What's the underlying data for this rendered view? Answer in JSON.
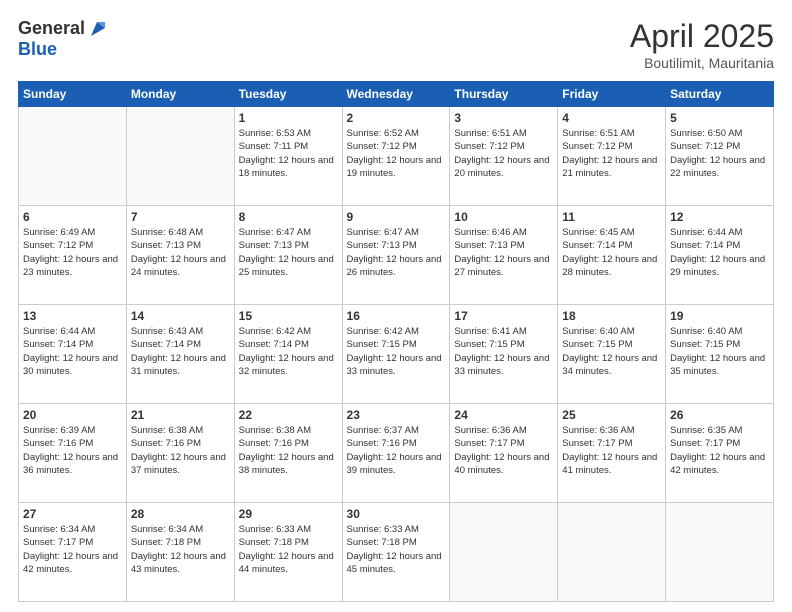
{
  "logo": {
    "general": "General",
    "blue": "Blue"
  },
  "title": "April 2025",
  "location": "Boutilimit, Mauritania",
  "days_of_week": [
    "Sunday",
    "Monday",
    "Tuesday",
    "Wednesday",
    "Thursday",
    "Friday",
    "Saturday"
  ],
  "weeks": [
    [
      {
        "day": "",
        "info": ""
      },
      {
        "day": "",
        "info": ""
      },
      {
        "day": "1",
        "info": "Sunrise: 6:53 AM\nSunset: 7:11 PM\nDaylight: 12 hours and 18 minutes."
      },
      {
        "day": "2",
        "info": "Sunrise: 6:52 AM\nSunset: 7:12 PM\nDaylight: 12 hours and 19 minutes."
      },
      {
        "day": "3",
        "info": "Sunrise: 6:51 AM\nSunset: 7:12 PM\nDaylight: 12 hours and 20 minutes."
      },
      {
        "day": "4",
        "info": "Sunrise: 6:51 AM\nSunset: 7:12 PM\nDaylight: 12 hours and 21 minutes."
      },
      {
        "day": "5",
        "info": "Sunrise: 6:50 AM\nSunset: 7:12 PM\nDaylight: 12 hours and 22 minutes."
      }
    ],
    [
      {
        "day": "6",
        "info": "Sunrise: 6:49 AM\nSunset: 7:12 PM\nDaylight: 12 hours and 23 minutes."
      },
      {
        "day": "7",
        "info": "Sunrise: 6:48 AM\nSunset: 7:13 PM\nDaylight: 12 hours and 24 minutes."
      },
      {
        "day": "8",
        "info": "Sunrise: 6:47 AM\nSunset: 7:13 PM\nDaylight: 12 hours and 25 minutes."
      },
      {
        "day": "9",
        "info": "Sunrise: 6:47 AM\nSunset: 7:13 PM\nDaylight: 12 hours and 26 minutes."
      },
      {
        "day": "10",
        "info": "Sunrise: 6:46 AM\nSunset: 7:13 PM\nDaylight: 12 hours and 27 minutes."
      },
      {
        "day": "11",
        "info": "Sunrise: 6:45 AM\nSunset: 7:14 PM\nDaylight: 12 hours and 28 minutes."
      },
      {
        "day": "12",
        "info": "Sunrise: 6:44 AM\nSunset: 7:14 PM\nDaylight: 12 hours and 29 minutes."
      }
    ],
    [
      {
        "day": "13",
        "info": "Sunrise: 6:44 AM\nSunset: 7:14 PM\nDaylight: 12 hours and 30 minutes."
      },
      {
        "day": "14",
        "info": "Sunrise: 6:43 AM\nSunset: 7:14 PM\nDaylight: 12 hours and 31 minutes."
      },
      {
        "day": "15",
        "info": "Sunrise: 6:42 AM\nSunset: 7:14 PM\nDaylight: 12 hours and 32 minutes."
      },
      {
        "day": "16",
        "info": "Sunrise: 6:42 AM\nSunset: 7:15 PM\nDaylight: 12 hours and 33 minutes."
      },
      {
        "day": "17",
        "info": "Sunrise: 6:41 AM\nSunset: 7:15 PM\nDaylight: 12 hours and 33 minutes."
      },
      {
        "day": "18",
        "info": "Sunrise: 6:40 AM\nSunset: 7:15 PM\nDaylight: 12 hours and 34 minutes."
      },
      {
        "day": "19",
        "info": "Sunrise: 6:40 AM\nSunset: 7:15 PM\nDaylight: 12 hours and 35 minutes."
      }
    ],
    [
      {
        "day": "20",
        "info": "Sunrise: 6:39 AM\nSunset: 7:16 PM\nDaylight: 12 hours and 36 minutes."
      },
      {
        "day": "21",
        "info": "Sunrise: 6:38 AM\nSunset: 7:16 PM\nDaylight: 12 hours and 37 minutes."
      },
      {
        "day": "22",
        "info": "Sunrise: 6:38 AM\nSunset: 7:16 PM\nDaylight: 12 hours and 38 minutes."
      },
      {
        "day": "23",
        "info": "Sunrise: 6:37 AM\nSunset: 7:16 PM\nDaylight: 12 hours and 39 minutes."
      },
      {
        "day": "24",
        "info": "Sunrise: 6:36 AM\nSunset: 7:17 PM\nDaylight: 12 hours and 40 minutes."
      },
      {
        "day": "25",
        "info": "Sunrise: 6:36 AM\nSunset: 7:17 PM\nDaylight: 12 hours and 41 minutes."
      },
      {
        "day": "26",
        "info": "Sunrise: 6:35 AM\nSunset: 7:17 PM\nDaylight: 12 hours and 42 minutes."
      }
    ],
    [
      {
        "day": "27",
        "info": "Sunrise: 6:34 AM\nSunset: 7:17 PM\nDaylight: 12 hours and 42 minutes."
      },
      {
        "day": "28",
        "info": "Sunrise: 6:34 AM\nSunset: 7:18 PM\nDaylight: 12 hours and 43 minutes."
      },
      {
        "day": "29",
        "info": "Sunrise: 6:33 AM\nSunset: 7:18 PM\nDaylight: 12 hours and 44 minutes."
      },
      {
        "day": "30",
        "info": "Sunrise: 6:33 AM\nSunset: 7:18 PM\nDaylight: 12 hours and 45 minutes."
      },
      {
        "day": "",
        "info": ""
      },
      {
        "day": "",
        "info": ""
      },
      {
        "day": "",
        "info": ""
      }
    ]
  ]
}
